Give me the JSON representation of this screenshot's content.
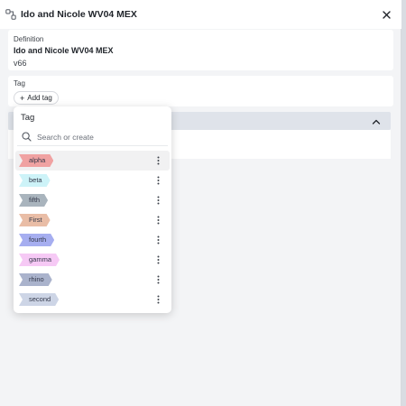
{
  "header": {
    "title": "Ido and Nicole WV04 MEX",
    "icon": "workflow-icon",
    "close_icon": "close-icon"
  },
  "definition": {
    "label": "Definition",
    "name": "Ido and Nicole WV04 MEX",
    "version": "v66"
  },
  "tag_field": {
    "label": "Tag",
    "add_label": "Add tag"
  },
  "dropdown": {
    "title": "Tag",
    "search_placeholder": "Search or create",
    "tags": [
      {
        "label": "alpha",
        "color": "#f0a2a2"
      },
      {
        "label": "beta",
        "color": "#cdf3f8"
      },
      {
        "label": "fifth",
        "color": "#a9b4bd"
      },
      {
        "label": "First",
        "color": "#e9bda6"
      },
      {
        "label": "fourth",
        "color": "#a6aef0"
      },
      {
        "label": "gamma",
        "color": "#f6c9f5"
      },
      {
        "label": "rhino",
        "color": "#aab3cc"
      },
      {
        "label": "second",
        "color": "#cdd5e6"
      }
    ]
  },
  "colors": {
    "panel_bg": "#f3f4f6",
    "section_bar": "#dfe3ea",
    "hover_row": "#f1f1f2"
  }
}
